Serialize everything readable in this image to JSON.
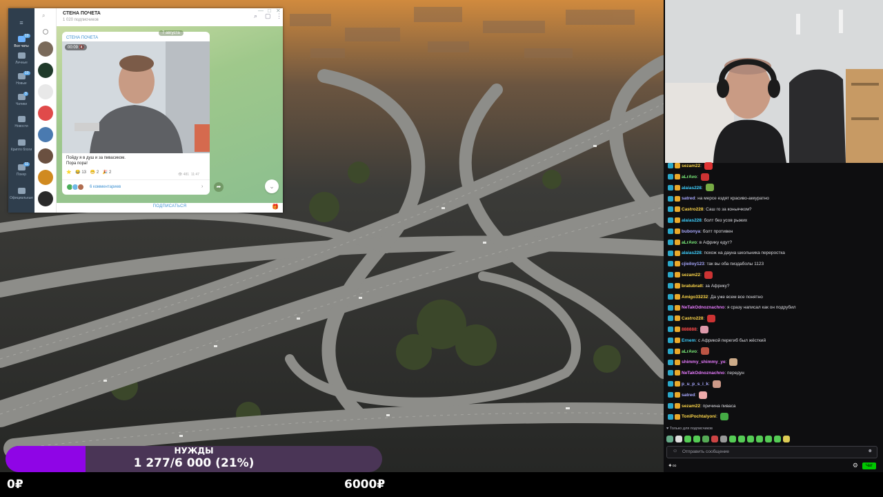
{
  "colors": {
    "goal_fill": "#8f05e6",
    "goal_track": "#4a3556",
    "chat_bg": "#0e0e10",
    "telegram_link": "#3a8fd0",
    "send_button": "#00c800"
  },
  "telegram": {
    "folders": [
      {
        "label": "Все чаты",
        "badge": "10",
        "icon": "chat-bubble-icon",
        "active": true
      },
      {
        "label": "Личные",
        "badge": "",
        "icon": "folder-icon",
        "active": false
      },
      {
        "label": "Новые",
        "badge": "10",
        "icon": "folder-icon",
        "active": false
      },
      {
        "label": "Чатики",
        "badge": "3",
        "icon": "folder-icon",
        "active": false
      },
      {
        "label": "Новости",
        "badge": "",
        "icon": "folder-icon",
        "active": false
      },
      {
        "label": "Крипто блоги",
        "badge": "",
        "icon": "folder-icon",
        "active": false
      },
      {
        "label": "Покер",
        "badge": "11",
        "icon": "folder-icon",
        "active": false
      },
      {
        "label": "Официальные",
        "badge": "",
        "icon": "folder-icon",
        "active": false
      }
    ],
    "channel_title": "СТЕНА ПОЧЕТА",
    "subscribers": "1 020 подписчиков",
    "date_chip": "7 августа",
    "message": {
      "channel": "СТЕНА ПОЧЕТА",
      "duration": "00:09",
      "line1": "Пойду я в душ и за пивасиком.",
      "line2": "Пора пора!",
      "reactions": [
        {
          "emoji": "⭐",
          "count": ""
        },
        {
          "emoji": "😂",
          "count": "13"
        },
        {
          "emoji": "😁",
          "count": "2"
        },
        {
          "emoji": "🎉",
          "count": "2"
        }
      ],
      "views": "481",
      "time": "11:47",
      "comments": "6 комментариев"
    },
    "subscribe_label": "ПОДПИСАТЬСЯ"
  },
  "chat": {
    "messages": [
      {
        "nick": "sezam22",
        "color": "#ffd84a",
        "text": "",
        "emote": "#d33"
      },
      {
        "nick": "aLrAvo",
        "color": "#7cf17c",
        "text": "",
        "emote": "#c33"
      },
      {
        "nick": "alaias228",
        "color": "#3fd0ff",
        "text": "",
        "emote": "#7a4"
      },
      {
        "nick": "satred",
        "color": "#a9a9ff",
        "text": "на мерсе ездят красиво-аккуратно",
        "emote": ""
      },
      {
        "nick": "Castro228",
        "color": "#ffd84a",
        "text": "Саш го за коньячком?",
        "emote": ""
      },
      {
        "nick": "alaias228",
        "color": "#3fd0ff",
        "text": "болт без усов рыжих",
        "emote": ""
      },
      {
        "nick": "bubonya",
        "color": "#a9a9ff",
        "text": "болт противен",
        "emote": ""
      },
      {
        "nick": "aLrAvo",
        "color": "#7cf17c",
        "text": "в Африку едут?",
        "emote": ""
      },
      {
        "nick": "alaias228",
        "color": "#3fd0ff",
        "text": "похож на дауна школьника переростка",
        "emote": ""
      },
      {
        "nick": "cjieiloy123",
        "color": "#a9a9ff",
        "text": "так вы оба пиздаболы 1123",
        "emote": ""
      },
      {
        "nick": "sezam22",
        "color": "#ffd84a",
        "text": "",
        "emote": "#c33"
      },
      {
        "nick": "bratubratt",
        "color": "#ffd84a",
        "text": "за Африку?",
        "emote": ""
      },
      {
        "nick": "Amigo33232",
        "color": "#ffd84a",
        "text": "Да уже всем все понятно",
        "emote": ""
      },
      {
        "nick": "NeTakOdnoznachno",
        "color": "#e87cff",
        "text": "я сразу написал как он подрубил",
        "emote": ""
      },
      {
        "nick": "Castro228",
        "color": "#ffd84a",
        "text": "",
        "emote": "#c33"
      },
      {
        "nick": "888888",
        "color": "#ff4a4a",
        "text": "",
        "emote": "#d9a"
      },
      {
        "nick": "Ernem",
        "color": "#3fd0ff",
        "text": "с Африкой перегиб был жёсткий",
        "emote": ""
      },
      {
        "nick": "aLrAvo",
        "color": "#7cf17c",
        "text": "",
        "emote": "#b54"
      },
      {
        "nick": "shimmy_shimmy_ye",
        "color": "#e87cff",
        "text": "",
        "emote": "#ca8"
      },
      {
        "nick": "NeTakOdnoznachno",
        "color": "#e87cff",
        "text": "передун",
        "emote": ""
      },
      {
        "nick": "p_u_p_s_i_k",
        "color": "#a9a9ff",
        "text": "",
        "emote": "#c98"
      },
      {
        "nick": "satred",
        "color": "#a9a9ff",
        "text": "",
        "emote": "#eaa"
      },
      {
        "nick": "sezam22",
        "color": "#ffd84a",
        "text": "причина пиваса",
        "emote": ""
      },
      {
        "nick": "ToniPochtalyoni",
        "color": "#ffd84a",
        "text": "",
        "emote": "#4a4"
      }
    ],
    "sub_only": "Только для подписчиков",
    "emote_colors": [
      "#6a8",
      "#ddd",
      "#5c5",
      "#5c5",
      "#5a5",
      "#c44",
      "#999",
      "#5c5",
      "#5c5",
      "#5c5",
      "#5c5",
      "#5c5",
      "#5c5",
      "#dc5"
    ],
    "input_placeholder": "Отправить сообщение",
    "send_label": "Чат"
  },
  "goal": {
    "title": "НУЖДЫ",
    "value_text": "1 277/6 000 (21%)",
    "current": 1277,
    "target": 6000,
    "min_label": "0₽",
    "max_label": "6000₽"
  }
}
